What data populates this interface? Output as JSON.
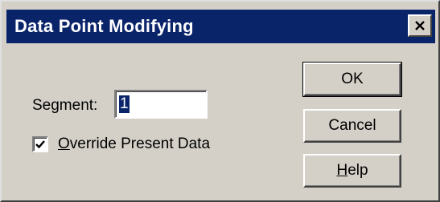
{
  "window": {
    "title": "Data Point Modifying",
    "close_label": "close"
  },
  "form": {
    "segment_label": "Segment:",
    "segment_value": "1",
    "override_label_first": "O",
    "override_label_rest": "verride Present Data",
    "override_checked": true
  },
  "buttons": {
    "ok_label": "OK",
    "cancel_label": "Cancel",
    "help_first": "H",
    "help_rest": "elp"
  },
  "colors": {
    "titlebar": "#0a246a",
    "face": "#d4d0c8",
    "selection": "#0a246a"
  },
  "icons": {
    "close": "close-icon",
    "check": "checkmark-icon"
  }
}
